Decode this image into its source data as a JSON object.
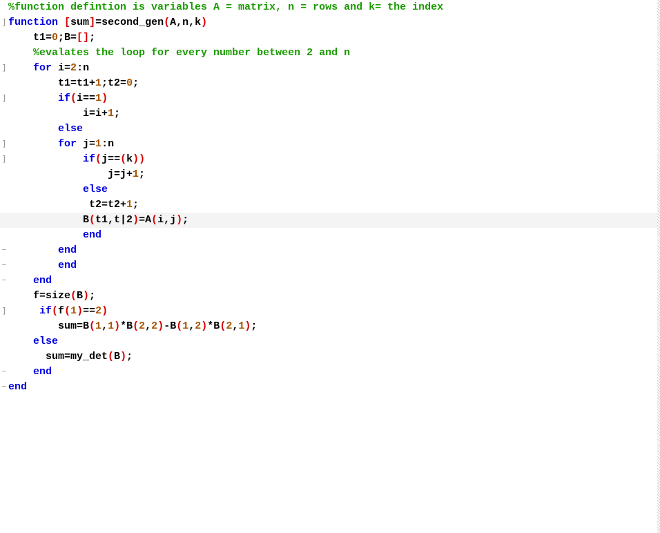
{
  "gutter": {
    "bracket": "]",
    "dash": "−",
    "empty": ""
  },
  "lines": [
    {
      "g": "empty",
      "hl": false,
      "seg": [
        {
          "cls": "c-comment",
          "t": "%function defintion is variables A = matrix, n = rows and k= the index"
        }
      ]
    },
    {
      "g": "bracket",
      "hl": false,
      "seg": [
        {
          "cls": "c-keyword",
          "t": "function"
        },
        {
          "cls": "c-default",
          "t": " "
        },
        {
          "cls": "c-paren",
          "t": "["
        },
        {
          "cls": "c-default",
          "t": "sum"
        },
        {
          "cls": "c-paren",
          "t": "]"
        },
        {
          "cls": "c-default",
          "t": "=second_gen"
        },
        {
          "cls": "c-paren",
          "t": "("
        },
        {
          "cls": "c-default",
          "t": "A,n,k"
        },
        {
          "cls": "c-paren",
          "t": ")"
        }
      ]
    },
    {
      "g": "empty",
      "hl": false,
      "seg": [
        {
          "cls": "c-default",
          "t": "    t1="
        },
        {
          "cls": "c-number",
          "t": "0"
        },
        {
          "cls": "c-default",
          "t": ";B="
        },
        {
          "cls": "c-paren",
          "t": "[]"
        },
        {
          "cls": "c-default",
          "t": ";"
        }
      ]
    },
    {
      "g": "empty",
      "hl": false,
      "seg": [
        {
          "cls": "c-default",
          "t": "    "
        },
        {
          "cls": "c-comment",
          "t": "%evalates the loop for every number between 2 and n"
        }
      ]
    },
    {
      "g": "bracket",
      "hl": false,
      "seg": [
        {
          "cls": "c-default",
          "t": "    "
        },
        {
          "cls": "c-keyword",
          "t": "for"
        },
        {
          "cls": "c-default",
          "t": " i="
        },
        {
          "cls": "c-number",
          "t": "2"
        },
        {
          "cls": "c-default",
          "t": ":n"
        }
      ]
    },
    {
      "g": "empty",
      "hl": false,
      "seg": [
        {
          "cls": "c-default",
          "t": "        t1=t1+"
        },
        {
          "cls": "c-number",
          "t": "1"
        },
        {
          "cls": "c-default",
          "t": ";t2="
        },
        {
          "cls": "c-number",
          "t": "0"
        },
        {
          "cls": "c-default",
          "t": ";"
        }
      ]
    },
    {
      "g": "bracket",
      "hl": false,
      "seg": [
        {
          "cls": "c-default",
          "t": "        "
        },
        {
          "cls": "c-keyword",
          "t": "if"
        },
        {
          "cls": "c-paren",
          "t": "("
        },
        {
          "cls": "c-default",
          "t": "i=="
        },
        {
          "cls": "c-number",
          "t": "1"
        },
        {
          "cls": "c-paren",
          "t": ")"
        }
      ]
    },
    {
      "g": "empty",
      "hl": false,
      "seg": [
        {
          "cls": "c-default",
          "t": "            i=i+"
        },
        {
          "cls": "c-number",
          "t": "1"
        },
        {
          "cls": "c-default",
          "t": ";"
        }
      ]
    },
    {
      "g": "empty",
      "hl": false,
      "seg": [
        {
          "cls": "c-default",
          "t": "        "
        },
        {
          "cls": "c-keyword",
          "t": "else"
        }
      ]
    },
    {
      "g": "bracket",
      "hl": false,
      "seg": [
        {
          "cls": "c-default",
          "t": "        "
        },
        {
          "cls": "c-keyword",
          "t": "for"
        },
        {
          "cls": "c-default",
          "t": " j="
        },
        {
          "cls": "c-number",
          "t": "1"
        },
        {
          "cls": "c-default",
          "t": ":n"
        }
      ]
    },
    {
      "g": "bracket",
      "hl": false,
      "seg": [
        {
          "cls": "c-default",
          "t": "            "
        },
        {
          "cls": "c-keyword",
          "t": "if"
        },
        {
          "cls": "c-paren",
          "t": "("
        },
        {
          "cls": "c-default",
          "t": "j=="
        },
        {
          "cls": "c-paren",
          "t": "("
        },
        {
          "cls": "c-default",
          "t": "k"
        },
        {
          "cls": "c-paren",
          "t": "))"
        }
      ]
    },
    {
      "g": "empty",
      "hl": false,
      "seg": [
        {
          "cls": "c-default",
          "t": "                j=j+"
        },
        {
          "cls": "c-number",
          "t": "1"
        },
        {
          "cls": "c-default",
          "t": ";"
        }
      ]
    },
    {
      "g": "empty",
      "hl": false,
      "seg": [
        {
          "cls": "c-default",
          "t": "            "
        },
        {
          "cls": "c-keyword",
          "t": "else"
        }
      ]
    },
    {
      "g": "empty",
      "hl": false,
      "seg": [
        {
          "cls": "c-default",
          "t": "             t2=t2+"
        },
        {
          "cls": "c-number",
          "t": "1"
        },
        {
          "cls": "c-default",
          "t": ";"
        }
      ]
    },
    {
      "g": "empty",
      "hl": true,
      "seg": [
        {
          "cls": "c-default",
          "t": "            B"
        },
        {
          "cls": "c-paren",
          "t": "("
        },
        {
          "cls": "c-default",
          "t": "t1,t|2"
        },
        {
          "cls": "c-paren",
          "t": ")"
        },
        {
          "cls": "c-default",
          "t": "=A"
        },
        {
          "cls": "c-paren",
          "t": "("
        },
        {
          "cls": "c-default",
          "t": "i,j"
        },
        {
          "cls": "c-paren",
          "t": ")"
        },
        {
          "cls": "c-default",
          "t": ";"
        }
      ]
    },
    {
      "g": "empty",
      "hl": false,
      "seg": [
        {
          "cls": "c-default",
          "t": "            "
        },
        {
          "cls": "c-keyword",
          "t": "end"
        }
      ]
    },
    {
      "g": "dash",
      "hl": false,
      "seg": [
        {
          "cls": "c-default",
          "t": "        "
        },
        {
          "cls": "c-keyword",
          "t": "end"
        }
      ]
    },
    {
      "g": "dash",
      "hl": false,
      "seg": [
        {
          "cls": "c-default",
          "t": "        "
        },
        {
          "cls": "c-keyword",
          "t": "end"
        }
      ]
    },
    {
      "g": "dash",
      "hl": false,
      "seg": [
        {
          "cls": "c-default",
          "t": "    "
        },
        {
          "cls": "c-keyword",
          "t": "end"
        }
      ]
    },
    {
      "g": "empty",
      "hl": false,
      "seg": [
        {
          "cls": "c-default",
          "t": "    f=size"
        },
        {
          "cls": "c-paren",
          "t": "("
        },
        {
          "cls": "c-default",
          "t": "B"
        },
        {
          "cls": "c-paren",
          "t": ")"
        },
        {
          "cls": "c-default",
          "t": ";"
        }
      ]
    },
    {
      "g": "bracket",
      "hl": false,
      "seg": [
        {
          "cls": "c-default",
          "t": "     "
        },
        {
          "cls": "c-keyword",
          "t": "if"
        },
        {
          "cls": "c-paren",
          "t": "("
        },
        {
          "cls": "c-default",
          "t": "f"
        },
        {
          "cls": "c-paren",
          "t": "("
        },
        {
          "cls": "c-number",
          "t": "1"
        },
        {
          "cls": "c-paren",
          "t": ")"
        },
        {
          "cls": "c-default",
          "t": "=="
        },
        {
          "cls": "c-number",
          "t": "2"
        },
        {
          "cls": "c-paren",
          "t": ")"
        }
      ]
    },
    {
      "g": "empty",
      "hl": false,
      "seg": [
        {
          "cls": "c-default",
          "t": "        sum=B"
        },
        {
          "cls": "c-paren",
          "t": "("
        },
        {
          "cls": "c-number",
          "t": "1"
        },
        {
          "cls": "c-default",
          "t": ","
        },
        {
          "cls": "c-number",
          "t": "1"
        },
        {
          "cls": "c-paren",
          "t": ")"
        },
        {
          "cls": "c-default",
          "t": "*B"
        },
        {
          "cls": "c-paren",
          "t": "("
        },
        {
          "cls": "c-number",
          "t": "2"
        },
        {
          "cls": "c-default",
          "t": ","
        },
        {
          "cls": "c-number",
          "t": "2"
        },
        {
          "cls": "c-paren",
          "t": ")"
        },
        {
          "cls": "c-default",
          "t": "-B"
        },
        {
          "cls": "c-paren",
          "t": "("
        },
        {
          "cls": "c-number",
          "t": "1"
        },
        {
          "cls": "c-default",
          "t": ","
        },
        {
          "cls": "c-number",
          "t": "2"
        },
        {
          "cls": "c-paren",
          "t": ")"
        },
        {
          "cls": "c-default",
          "t": "*B"
        },
        {
          "cls": "c-paren",
          "t": "("
        },
        {
          "cls": "c-number",
          "t": "2"
        },
        {
          "cls": "c-default",
          "t": ","
        },
        {
          "cls": "c-number",
          "t": "1"
        },
        {
          "cls": "c-paren",
          "t": ")"
        },
        {
          "cls": "c-default",
          "t": ";"
        }
      ]
    },
    {
      "g": "empty",
      "hl": false,
      "seg": [
        {
          "cls": "c-default",
          "t": "    "
        },
        {
          "cls": "c-keyword",
          "t": "else"
        }
      ]
    },
    {
      "g": "empty",
      "hl": false,
      "seg": [
        {
          "cls": "c-default",
          "t": "      sum=my_det"
        },
        {
          "cls": "c-paren",
          "t": "("
        },
        {
          "cls": "c-default",
          "t": "B"
        },
        {
          "cls": "c-paren",
          "t": ")"
        },
        {
          "cls": "c-default",
          "t": ";"
        }
      ]
    },
    {
      "g": "dash",
      "hl": false,
      "seg": [
        {
          "cls": "c-default",
          "t": "    "
        },
        {
          "cls": "c-keyword",
          "t": "end"
        }
      ]
    },
    {
      "g": "dash",
      "hl": false,
      "seg": [
        {
          "cls": "c-keyword",
          "t": "end"
        }
      ]
    }
  ]
}
